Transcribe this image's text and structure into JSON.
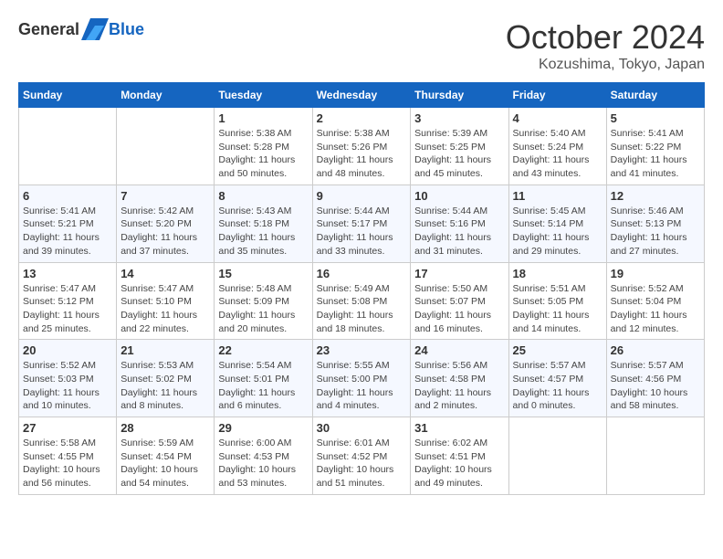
{
  "header": {
    "logo_general": "General",
    "logo_blue": "Blue",
    "month": "October 2024",
    "location": "Kozushima, Tokyo, Japan"
  },
  "columns": [
    "Sunday",
    "Monday",
    "Tuesday",
    "Wednesday",
    "Thursday",
    "Friday",
    "Saturday"
  ],
  "weeks": [
    [
      {
        "day": "",
        "info": ""
      },
      {
        "day": "",
        "info": ""
      },
      {
        "day": "1",
        "info": "Sunrise: 5:38 AM\nSunset: 5:28 PM\nDaylight: 11 hours and 50 minutes."
      },
      {
        "day": "2",
        "info": "Sunrise: 5:38 AM\nSunset: 5:26 PM\nDaylight: 11 hours and 48 minutes."
      },
      {
        "day": "3",
        "info": "Sunrise: 5:39 AM\nSunset: 5:25 PM\nDaylight: 11 hours and 45 minutes."
      },
      {
        "day": "4",
        "info": "Sunrise: 5:40 AM\nSunset: 5:24 PM\nDaylight: 11 hours and 43 minutes."
      },
      {
        "day": "5",
        "info": "Sunrise: 5:41 AM\nSunset: 5:22 PM\nDaylight: 11 hours and 41 minutes."
      }
    ],
    [
      {
        "day": "6",
        "info": "Sunrise: 5:41 AM\nSunset: 5:21 PM\nDaylight: 11 hours and 39 minutes."
      },
      {
        "day": "7",
        "info": "Sunrise: 5:42 AM\nSunset: 5:20 PM\nDaylight: 11 hours and 37 minutes."
      },
      {
        "day": "8",
        "info": "Sunrise: 5:43 AM\nSunset: 5:18 PM\nDaylight: 11 hours and 35 minutes."
      },
      {
        "day": "9",
        "info": "Sunrise: 5:44 AM\nSunset: 5:17 PM\nDaylight: 11 hours and 33 minutes."
      },
      {
        "day": "10",
        "info": "Sunrise: 5:44 AM\nSunset: 5:16 PM\nDaylight: 11 hours and 31 minutes."
      },
      {
        "day": "11",
        "info": "Sunrise: 5:45 AM\nSunset: 5:14 PM\nDaylight: 11 hours and 29 minutes."
      },
      {
        "day": "12",
        "info": "Sunrise: 5:46 AM\nSunset: 5:13 PM\nDaylight: 11 hours and 27 minutes."
      }
    ],
    [
      {
        "day": "13",
        "info": "Sunrise: 5:47 AM\nSunset: 5:12 PM\nDaylight: 11 hours and 25 minutes."
      },
      {
        "day": "14",
        "info": "Sunrise: 5:47 AM\nSunset: 5:10 PM\nDaylight: 11 hours and 22 minutes."
      },
      {
        "day": "15",
        "info": "Sunrise: 5:48 AM\nSunset: 5:09 PM\nDaylight: 11 hours and 20 minutes."
      },
      {
        "day": "16",
        "info": "Sunrise: 5:49 AM\nSunset: 5:08 PM\nDaylight: 11 hours and 18 minutes."
      },
      {
        "day": "17",
        "info": "Sunrise: 5:50 AM\nSunset: 5:07 PM\nDaylight: 11 hours and 16 minutes."
      },
      {
        "day": "18",
        "info": "Sunrise: 5:51 AM\nSunset: 5:05 PM\nDaylight: 11 hours and 14 minutes."
      },
      {
        "day": "19",
        "info": "Sunrise: 5:52 AM\nSunset: 5:04 PM\nDaylight: 11 hours and 12 minutes."
      }
    ],
    [
      {
        "day": "20",
        "info": "Sunrise: 5:52 AM\nSunset: 5:03 PM\nDaylight: 11 hours and 10 minutes."
      },
      {
        "day": "21",
        "info": "Sunrise: 5:53 AM\nSunset: 5:02 PM\nDaylight: 11 hours and 8 minutes."
      },
      {
        "day": "22",
        "info": "Sunrise: 5:54 AM\nSunset: 5:01 PM\nDaylight: 11 hours and 6 minutes."
      },
      {
        "day": "23",
        "info": "Sunrise: 5:55 AM\nSunset: 5:00 PM\nDaylight: 11 hours and 4 minutes."
      },
      {
        "day": "24",
        "info": "Sunrise: 5:56 AM\nSunset: 4:58 PM\nDaylight: 11 hours and 2 minutes."
      },
      {
        "day": "25",
        "info": "Sunrise: 5:57 AM\nSunset: 4:57 PM\nDaylight: 11 hours and 0 minutes."
      },
      {
        "day": "26",
        "info": "Sunrise: 5:57 AM\nSunset: 4:56 PM\nDaylight: 10 hours and 58 minutes."
      }
    ],
    [
      {
        "day": "27",
        "info": "Sunrise: 5:58 AM\nSunset: 4:55 PM\nDaylight: 10 hours and 56 minutes."
      },
      {
        "day": "28",
        "info": "Sunrise: 5:59 AM\nSunset: 4:54 PM\nDaylight: 10 hours and 54 minutes."
      },
      {
        "day": "29",
        "info": "Sunrise: 6:00 AM\nSunset: 4:53 PM\nDaylight: 10 hours and 53 minutes."
      },
      {
        "day": "30",
        "info": "Sunrise: 6:01 AM\nSunset: 4:52 PM\nDaylight: 10 hours and 51 minutes."
      },
      {
        "day": "31",
        "info": "Sunrise: 6:02 AM\nSunset: 4:51 PM\nDaylight: 10 hours and 49 minutes."
      },
      {
        "day": "",
        "info": ""
      },
      {
        "day": "",
        "info": ""
      }
    ]
  ]
}
